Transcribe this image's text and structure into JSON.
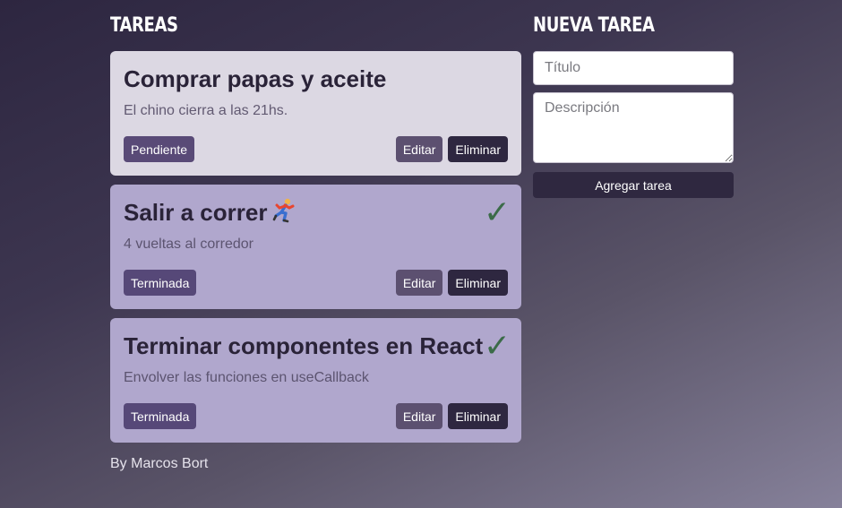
{
  "tasks_section": {
    "title": "TAREAS",
    "tasks": [
      {
        "title": "Comprar papas y aceite",
        "description": "El chino cierra a las 21hs.",
        "status_label": "Pendiente",
        "done": false
      },
      {
        "title": "Salir a correr",
        "emoji_icon": "running-person-icon",
        "description": "4 vueltas al corredor",
        "status_label": "Terminada",
        "done": true
      },
      {
        "title": "Terminar componentes en React",
        "description": "Envolver las funciones en useCallback",
        "status_label": "Terminada",
        "done": true
      }
    ],
    "edit_label": "Editar",
    "delete_label": "Eliminar",
    "check_mark": "✓"
  },
  "new_task_section": {
    "title": "NUEVA TAREA",
    "title_placeholder": "Título",
    "description_placeholder": "Descripción",
    "submit_label": "Agregar tarea"
  },
  "footer": {
    "text": "By Marcos Bort"
  },
  "colors": {
    "pending_card": "#dcd8e3",
    "done_card": "#b0a7cd",
    "check": "#3b6b48",
    "dark_button": "#2e2740"
  }
}
